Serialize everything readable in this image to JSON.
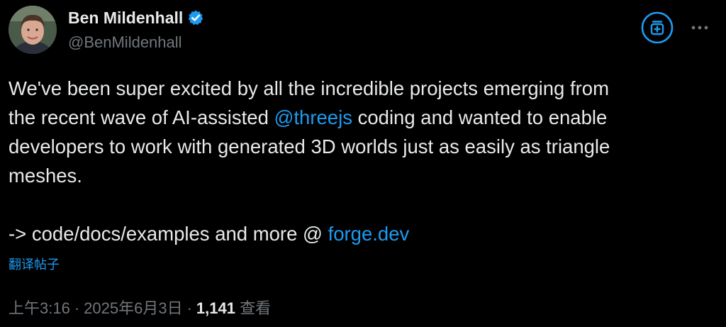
{
  "author": {
    "display_name": "Ben Mildenhall",
    "handle": "@BenMildenhall",
    "verified": true
  },
  "header_actions": {
    "grok_icon": "grok-plus-icon",
    "more_icon": "more-dots-icon"
  },
  "tweet": {
    "line1": "We've been super excited by all the incredible projects emerging from",
    "line2_before": "the recent wave of AI-assisted ",
    "line2_mention": "@threejs",
    "line2_after": " coding and wanted to enable",
    "line3": "developers to work with generated 3D worlds just as easily as triangle",
    "line4": "meshes.",
    "line5_before": "-> code/docs/examples and more @ ",
    "line5_link": "forge.dev"
  },
  "translate_label": "翻译帖子",
  "meta": {
    "time": "上午3:16",
    "separator": "·",
    "date": "2025年6月3日",
    "views": "1,141",
    "views_label": "查看"
  },
  "colors": {
    "background": "#000000",
    "text": "#e7e9ea",
    "secondary": "#71767b",
    "accent": "#1d9bf0"
  }
}
